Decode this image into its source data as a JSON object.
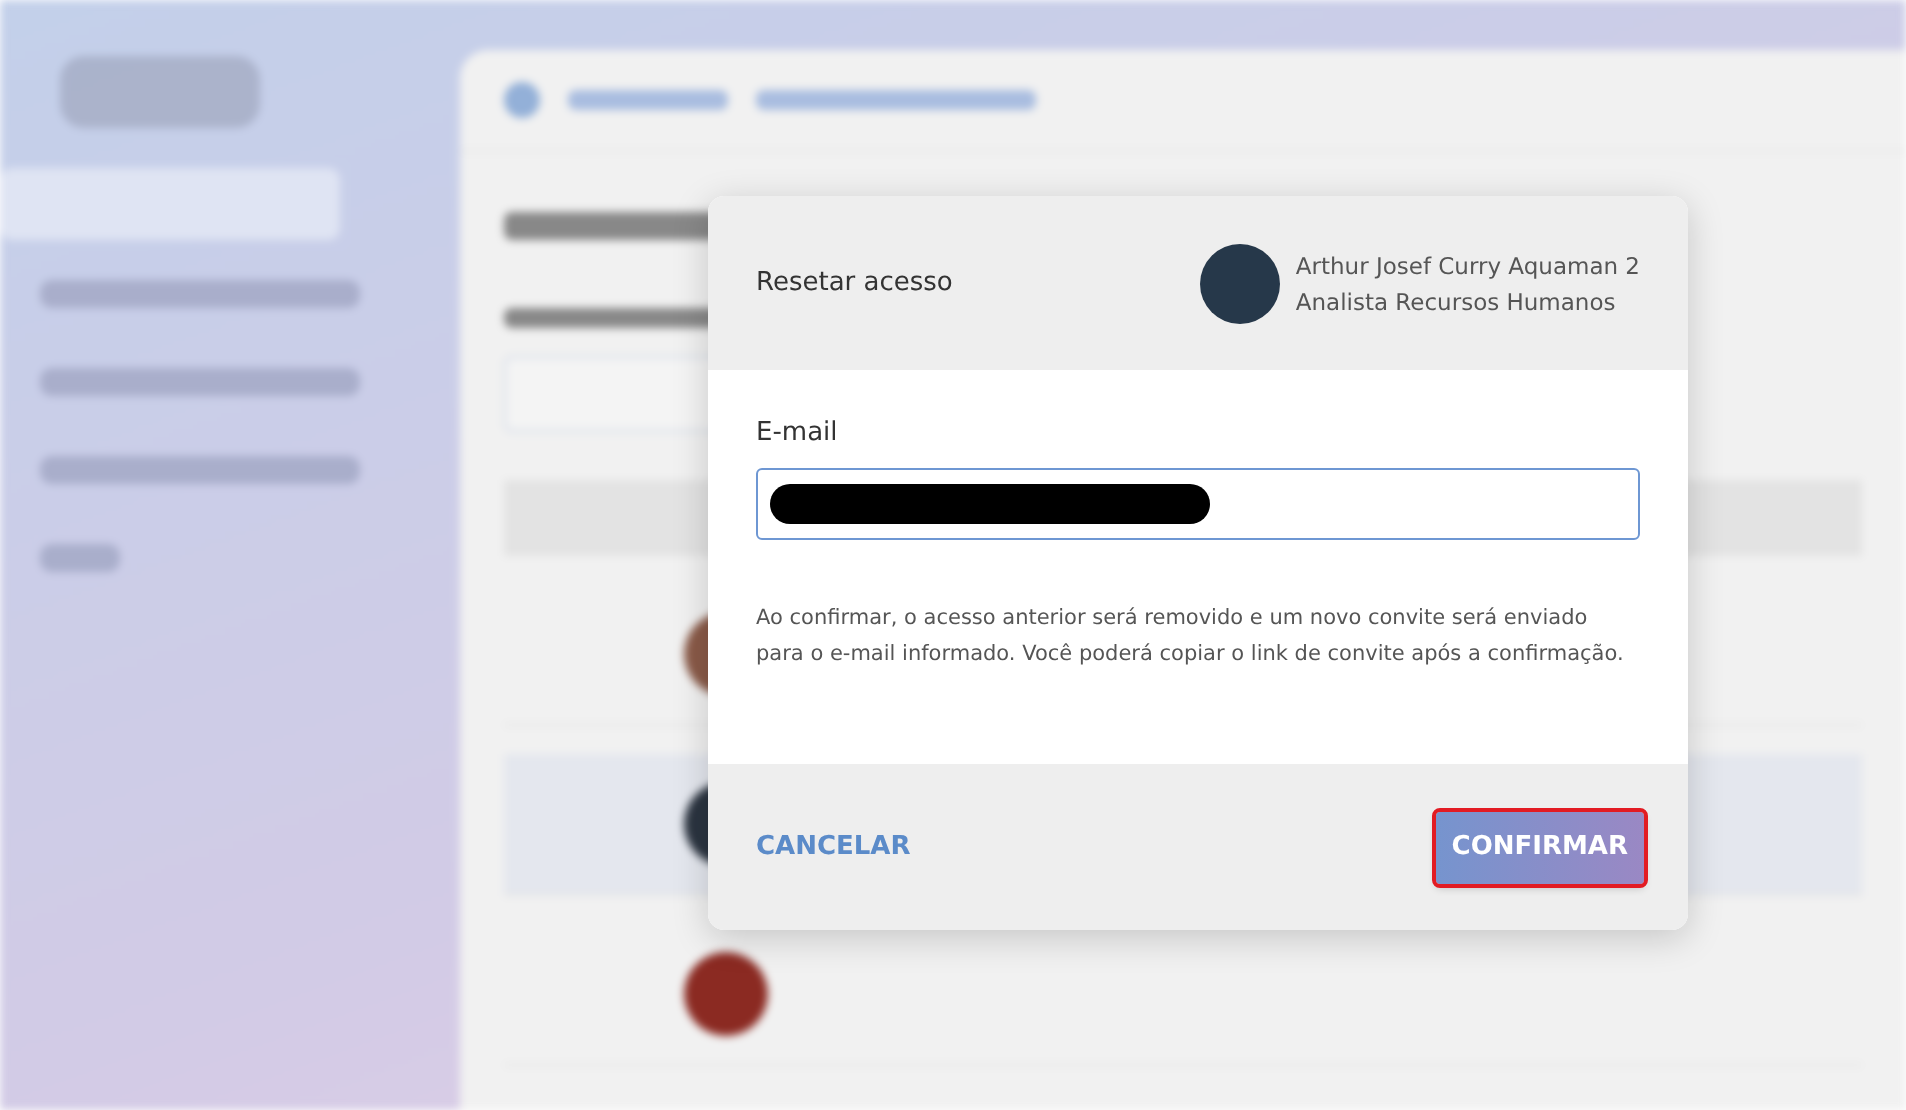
{
  "dialog": {
    "title": "Resetar acesso",
    "user": {
      "name": "Arthur Josef Curry Aquaman 2",
      "role": "Analista Recursos Humanos"
    },
    "email_field": {
      "label": "E-mail",
      "redacted": true
    },
    "message": "Ao confirmar, o acesso anterior será removido e um novo convite será enviado para o e-mail informado. Você poderá copiar o link de convite após a confirmação.",
    "buttons": [
      {
        "label": "CANCELAR",
        "kind": "text",
        "focused": false
      },
      {
        "label": "CONFIRMAR",
        "kind": "primary",
        "focused": true
      }
    ]
  }
}
